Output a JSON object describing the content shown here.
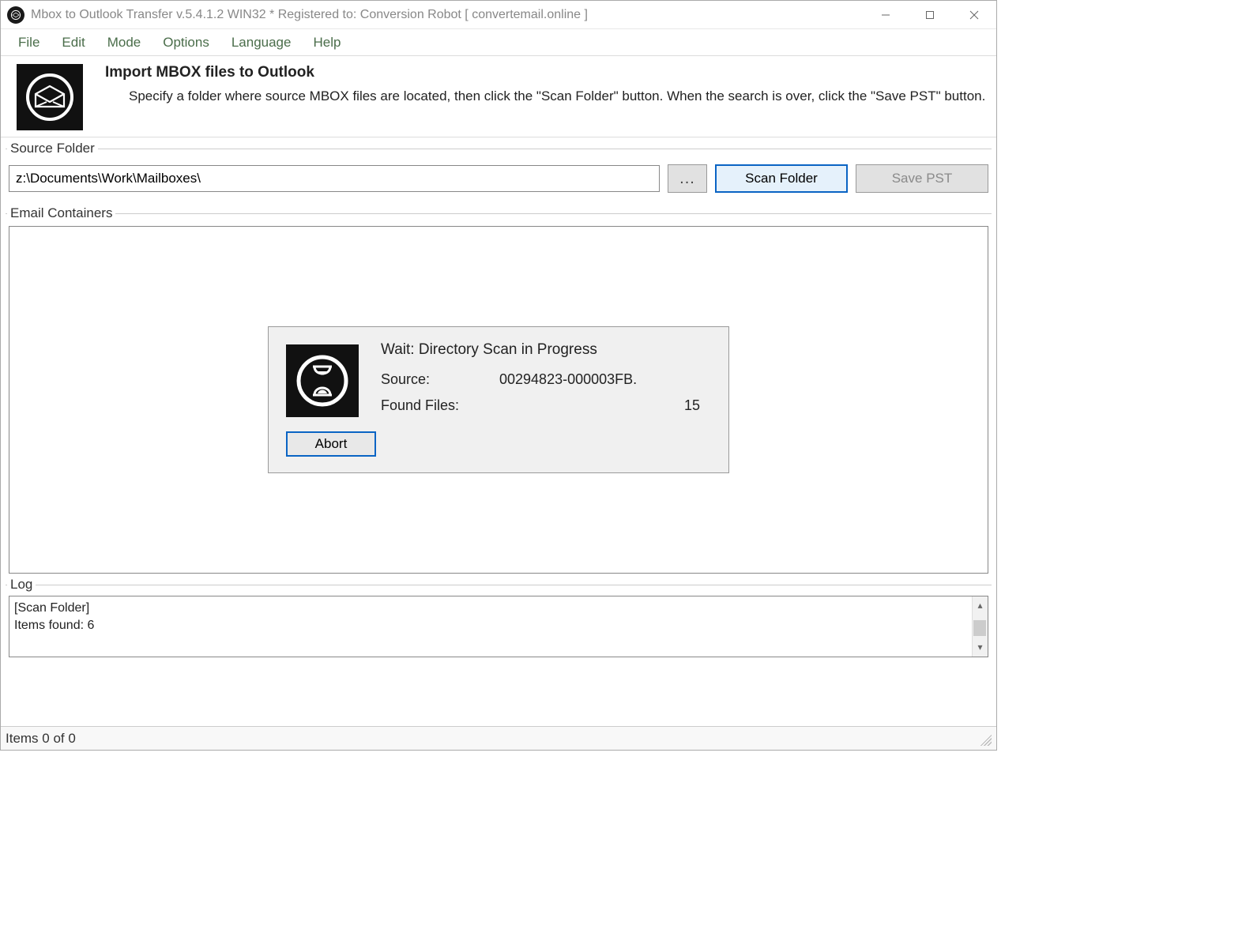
{
  "window": {
    "title": "Mbox to Outlook Transfer v.5.4.1.2 WIN32 * Registered to: Conversion Robot [ convertemail.online ]"
  },
  "menu": {
    "file": "File",
    "edit": "Edit",
    "mode": "Mode",
    "options": "Options",
    "language": "Language",
    "help": "Help"
  },
  "header": {
    "title": "Import MBOX files to Outlook",
    "description": "Specify a folder where source MBOX files are located, then click the \"Scan Folder\" button. When the search is over, click the \"Save PST\" button."
  },
  "source": {
    "legend": "Source Folder",
    "path": "z:\\Documents\\Work\\Mailboxes\\",
    "browse": "...",
    "scan": "Scan Folder",
    "savepst": "Save PST"
  },
  "containers": {
    "legend": "Email Containers"
  },
  "dialog": {
    "title": "Wait: Directory Scan in Progress",
    "source_label": "Source:",
    "source_value": "00294823-000003FB.",
    "found_label": "Found Files:",
    "found_value": "15",
    "abort": "Abort"
  },
  "log": {
    "legend": "Log",
    "line1": "[Scan Folder]",
    "line2": "Items found: 6"
  },
  "status": {
    "text": "Items 0 of 0"
  }
}
